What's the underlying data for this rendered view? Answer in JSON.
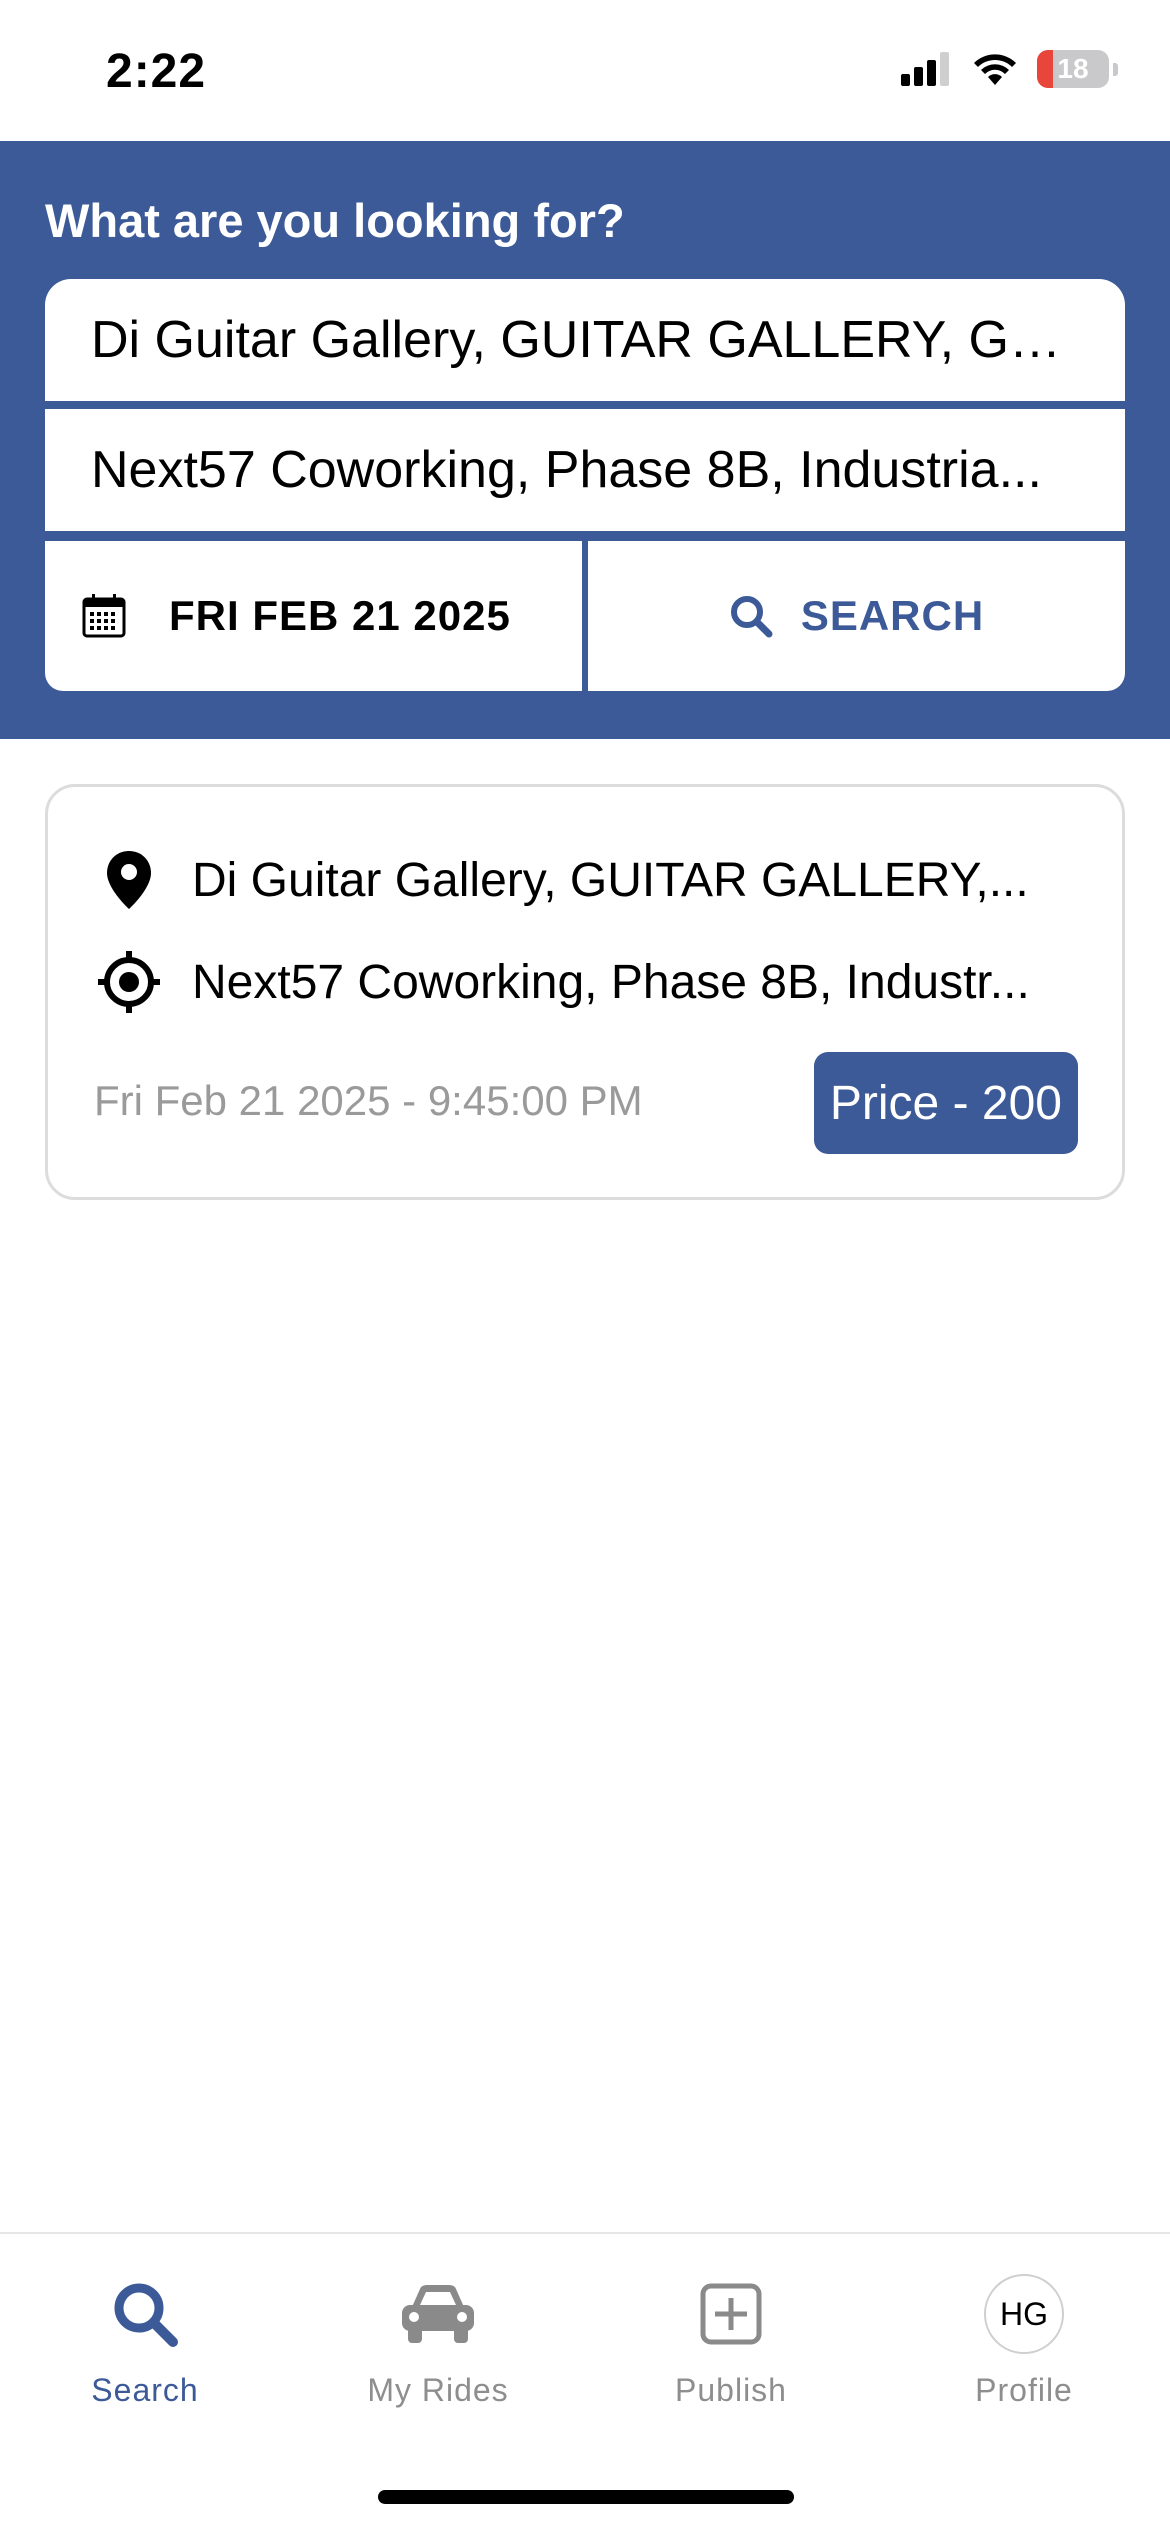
{
  "status_bar": {
    "time": "2:22",
    "battery_percent": "18",
    "icons": [
      "signal-icon",
      "wifi-icon",
      "battery-icon"
    ]
  },
  "search_panel": {
    "title": "What are you looking for?",
    "from_value": "Di Guitar Gallery, GUITAR GALLERY, GU...",
    "to_value": "Next57 Coworking, Phase 8B, Industria...",
    "date_label": "FRI FEB 21 2025",
    "search_label": "SEARCH",
    "background_color": "#3d5a98"
  },
  "results": [
    {
      "from": "Di Guitar Gallery, GUITAR GALLERY,...",
      "to": "Next57 Coworking, Phase 8B, Industr...",
      "datetime": "Fri Feb 21 2025 - 9:45:00 PM",
      "price": "Price - 200"
    }
  ],
  "tab_bar": {
    "tabs": [
      {
        "label": "Search",
        "icon": "search-icon",
        "active": true
      },
      {
        "label": "My Rides",
        "icon": "car-icon",
        "active": false
      },
      {
        "label": "Publish",
        "icon": "plus-square-icon",
        "active": false
      },
      {
        "label": "Profile",
        "icon": "avatar",
        "active": false
      }
    ],
    "avatar_initials": "HG",
    "active_color": "#3d5a98"
  }
}
